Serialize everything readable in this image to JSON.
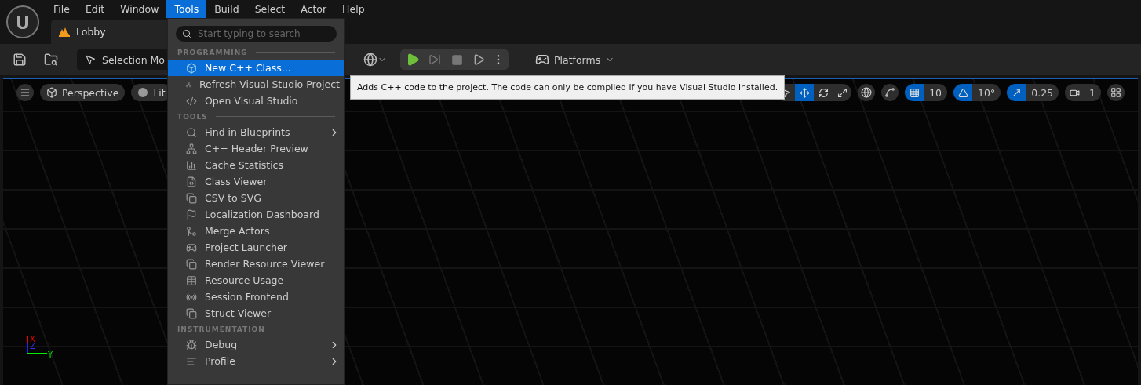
{
  "menubar": {
    "items": [
      {
        "label": "File",
        "selected": false
      },
      {
        "label": "Edit",
        "selected": false
      },
      {
        "label": "Window",
        "selected": false
      },
      {
        "label": "Tools",
        "selected": true
      },
      {
        "label": "Build",
        "selected": false
      },
      {
        "label": "Select",
        "selected": false
      },
      {
        "label": "Actor",
        "selected": false
      },
      {
        "label": "Help",
        "selected": false
      }
    ]
  },
  "tab": {
    "title": "Lobby"
  },
  "toolbar": {
    "mode": "Selection Mo",
    "platforms": "Platforms"
  },
  "viewport": {
    "view": "Perspective",
    "lighting": "Lit",
    "tools": [
      {
        "kind": "select",
        "selected": false
      },
      {
        "kind": "move",
        "selected": true
      },
      {
        "kind": "rotate",
        "selected": false
      },
      {
        "kind": "scale",
        "selected": false
      }
    ],
    "snaps": [
      {
        "kind": "grid",
        "on": true,
        "value": "10"
      },
      {
        "kind": "angle",
        "on": true,
        "value": "10°"
      },
      {
        "kind": "scale",
        "on": true,
        "value": "0.25"
      },
      {
        "kind": "camera",
        "on": false,
        "value": "1"
      }
    ],
    "axes": [
      "X",
      "Z",
      "Y"
    ]
  },
  "menu": {
    "search": {
      "placeholder": "Start typing to search"
    },
    "sections": [
      {
        "title": "PROGRAMMING",
        "items": [
          {
            "label": "New C++ Class...",
            "kind": "cube",
            "selected": true,
            "submenu": false
          },
          {
            "label": "Refresh Visual Studio Project",
            "kind": "refresh",
            "selected": false,
            "submenu": false
          },
          {
            "label": "Open Visual Studio",
            "kind": "vs",
            "selected": false,
            "submenu": false
          }
        ]
      },
      {
        "title": "TOOLS",
        "items": [
          {
            "label": "Find in Blueprints",
            "kind": "search",
            "selected": false,
            "submenu": true
          },
          {
            "label": "C++ Header Preview",
            "kind": "tree",
            "selected": false,
            "submenu": false
          },
          {
            "label": "Cache Statistics",
            "kind": "bars",
            "selected": false,
            "submenu": false
          },
          {
            "label": "Class Viewer",
            "kind": "file",
            "selected": false,
            "submenu": false
          },
          {
            "label": "CSV to SVG",
            "kind": "windows",
            "selected": false,
            "submenu": false
          },
          {
            "label": "Localization Dashboard",
            "kind": "flag",
            "selected": false,
            "submenu": false
          },
          {
            "label": "Merge Actors",
            "kind": "merge",
            "selected": false,
            "submenu": false
          },
          {
            "label": "Project Launcher",
            "kind": "gamepad",
            "selected": false,
            "submenu": false
          },
          {
            "label": "Render Resource Viewer",
            "kind": "windows",
            "selected": false,
            "submenu": false
          },
          {
            "label": "Resource Usage",
            "kind": "table",
            "selected": false,
            "submenu": false
          },
          {
            "label": "Session Frontend",
            "kind": "radio",
            "selected": false,
            "submenu": false
          },
          {
            "label": "Struct Viewer",
            "kind": "windows",
            "selected": false,
            "submenu": false
          }
        ]
      },
      {
        "title": "INSTRUMENTATION",
        "items": [
          {
            "label": "Debug",
            "kind": "bug",
            "selected": false,
            "submenu": true
          },
          {
            "label": "Profile",
            "kind": "lines",
            "selected": false,
            "submenu": true
          }
        ]
      }
    ]
  },
  "tooltip": "Adds C++ code to the project. The code can only be compiled if you have Visual Studio installed."
}
